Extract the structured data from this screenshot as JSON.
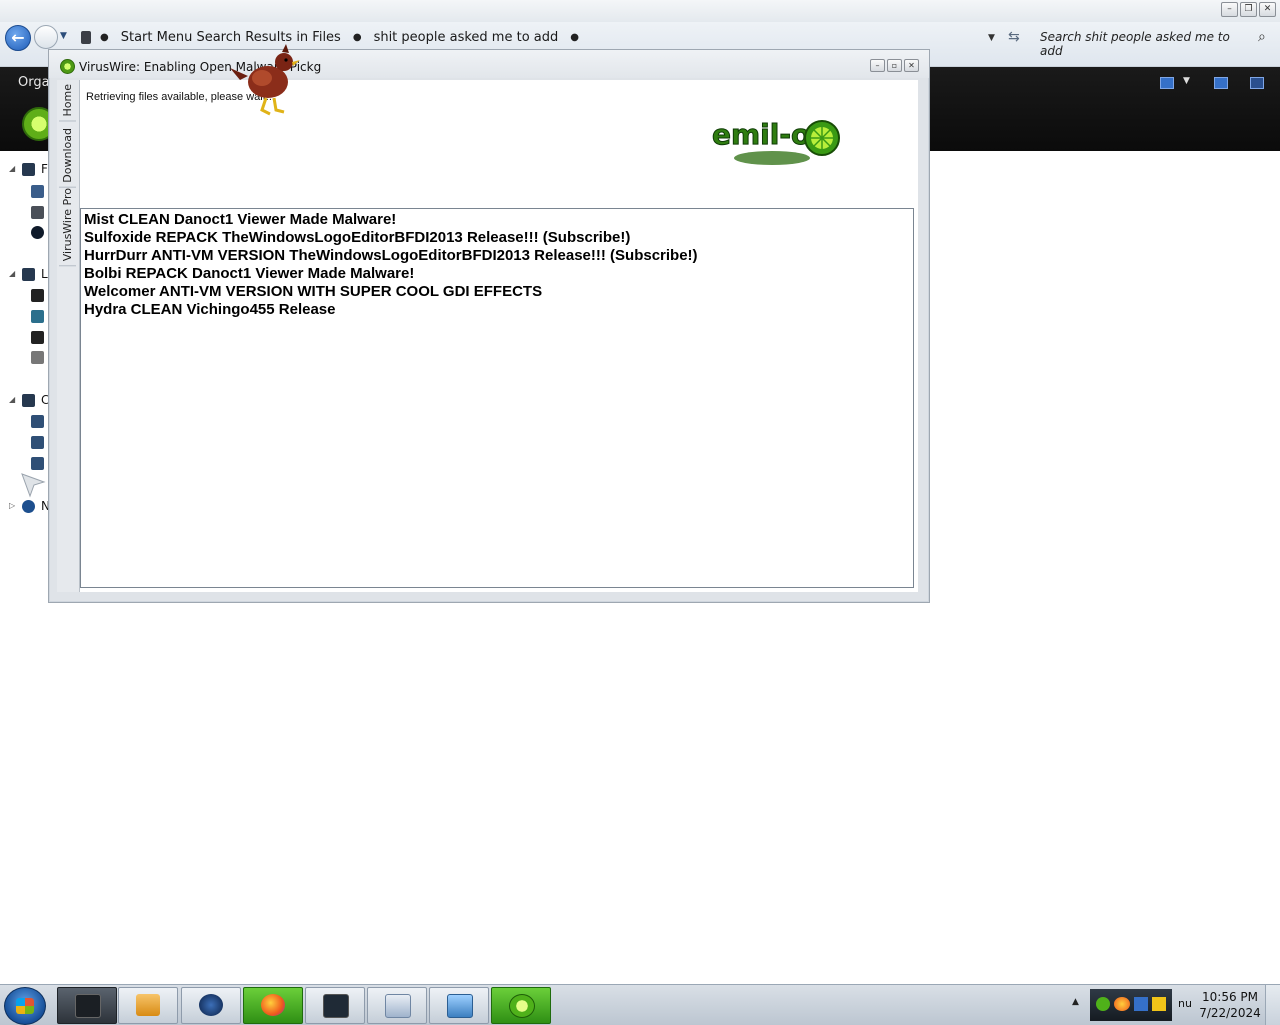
{
  "explorer": {
    "breadcrumb": [
      "Start Menu Search Results in Files",
      "shit people asked me to add"
    ],
    "search_placeholder": "Search shit people asked me to add",
    "toolbar_organize": "Organ",
    "nav_tree_labels": [
      "F",
      "L",
      "C",
      "N"
    ]
  },
  "dialog": {
    "title": "VirusWire: Enabling Open Malware Pickg",
    "tabs": [
      "Home",
      "Download",
      "VirusWire Pro"
    ],
    "status": "Retrieving files available, please wait...",
    "logo_text": "emil-o",
    "malware_items": [
      "Mist CLEAN Danoct1 Viewer Made Malware!",
      "Sulfoxide REPACK TheWindowsLogoEditorBFDI2013 Release!!! (Subscribe!)",
      "HurrDurr ANTI-VM VERSION TheWindowsLogoEditorBFDI2013 Release!!! (Subscribe!)",
      "Bolbi REPACK Danoct1 Viewer Made Malware!",
      "Welcomer ANTI-VM VERSION WITH SUPER COOL GDI EFFECTS",
      "Hydra CLEAN Vichingo455 Release"
    ]
  },
  "taskbar": {
    "clock_time": "10:56 PM",
    "clock_date": "7/22/2024",
    "tray_text": "nu",
    "buttons": [
      "terminal-app",
      "media-player",
      "globe-app",
      "firefox",
      "monitor-app",
      "keyboard-app",
      "photo-viewer",
      "viruswire-app"
    ]
  },
  "colors": {
    "accent_green": "#3fa515",
    "taskbar_bg": "#c9d2dc",
    "toolbar_bg": "#111111"
  }
}
